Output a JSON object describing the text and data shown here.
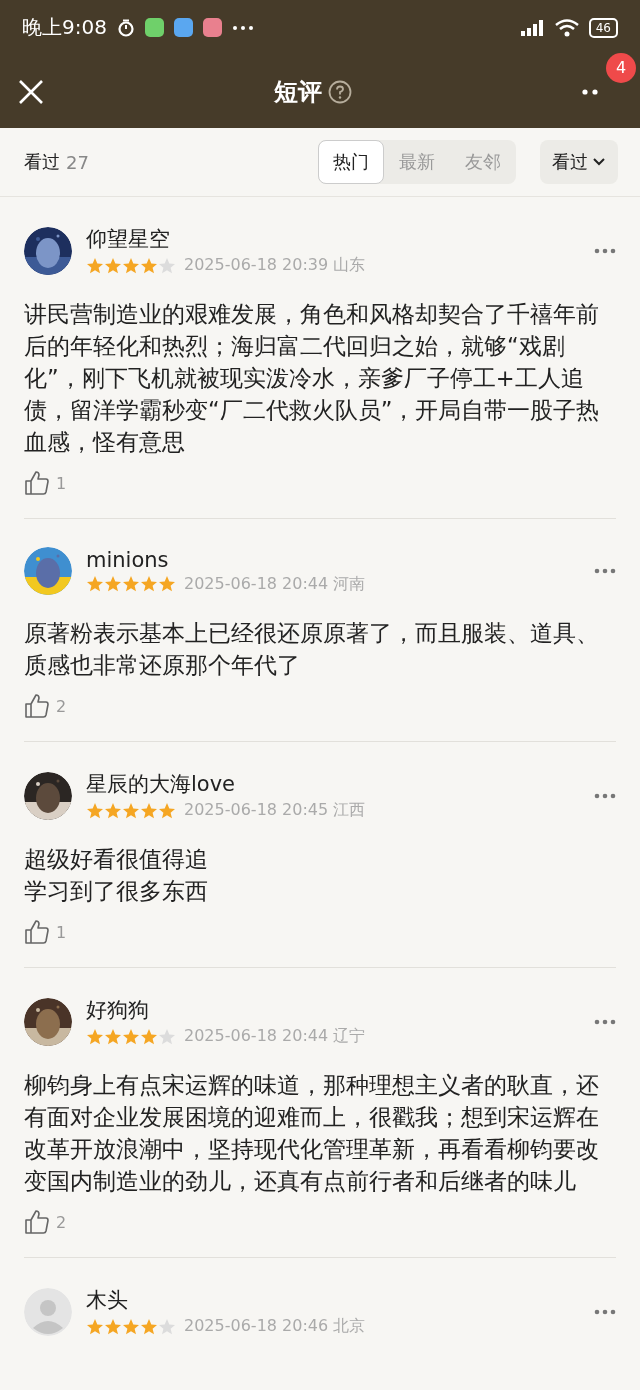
{
  "status_bar": {
    "time": "晚上9:08",
    "battery": "46"
  },
  "header": {
    "title": "短评",
    "badge": "4"
  },
  "filter_bar": {
    "label": "看过",
    "count": "27",
    "tabs": [
      {
        "label": "热门",
        "selected": true
      },
      {
        "label": "最新",
        "selected": false
      },
      {
        "label": "友邻",
        "selected": false
      }
    ],
    "sort": "看过"
  },
  "reviews": [
    {
      "name": "仰望星空",
      "stars": 4,
      "meta": "2025-06-18 20:39 山东",
      "text": "讲民营制造业的艰难发展，角色和风格却契合了千禧年前后的年轻化和热烈；海归富二代回归之始，就够“戏剧化”，刚下飞机就被现实泼冷水，亲爹厂子停工+工人追债，留洋学霸秒变“厂二代救火队员”，开局自带一股子热血感，怪有意思",
      "likes": "1"
    },
    {
      "name": "minions",
      "stars": 5,
      "meta": "2025-06-18 20:44 河南",
      "text": "原著粉表示基本上已经很还原原著了，而且服装、道具、质感也非常还原那个年代了",
      "likes": "2"
    },
    {
      "name": "星辰的大海love",
      "stars": 5,
      "meta": "2025-06-18 20:45 江西",
      "text": "超级好看很值得追",
      "text_2": "学习到了很多东西",
      "likes": "1"
    },
    {
      "name": "好狗狗",
      "stars": 4,
      "meta": "2025-06-18 20:44 辽宁",
      "text": "柳钧身上有点宋运辉的味道，那种理想主义者的耿直，还有面对企业发展困境的迎难而上，很戳我；想到宋运辉在改革开放浪潮中，坚持现代化管理革新，再看看柳钧要改变国内制造业的劲儿，还真有点前行者和后继者的味儿",
      "likes": "2"
    },
    {
      "name": "木头",
      "avatar": {
        "kind": "default"
      },
      "stars": 4,
      "meta": "2025-06-18 20:46 北京"
    }
  ]
}
